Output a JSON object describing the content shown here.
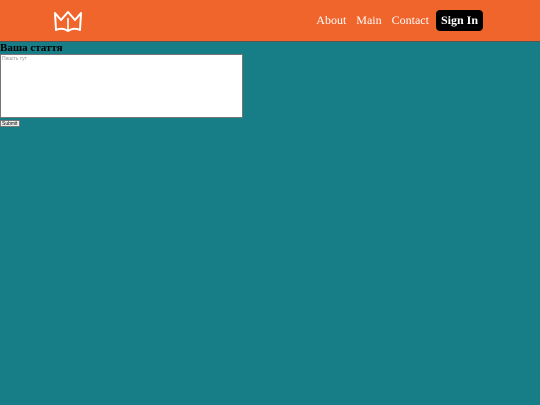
{
  "nav": {
    "logo_icon": "open-book-crown-icon",
    "links": [
      "About",
      "Main",
      "Contact"
    ],
    "sign_in_label": "Sign In"
  },
  "form": {
    "title": "Ваша стаття",
    "placeholder": "Пишіть тут",
    "value": "",
    "submit_label": "Submit"
  },
  "colors": {
    "header_bg": "#ef652c",
    "page_bg": "#177d87",
    "button_bg": "#000000"
  }
}
